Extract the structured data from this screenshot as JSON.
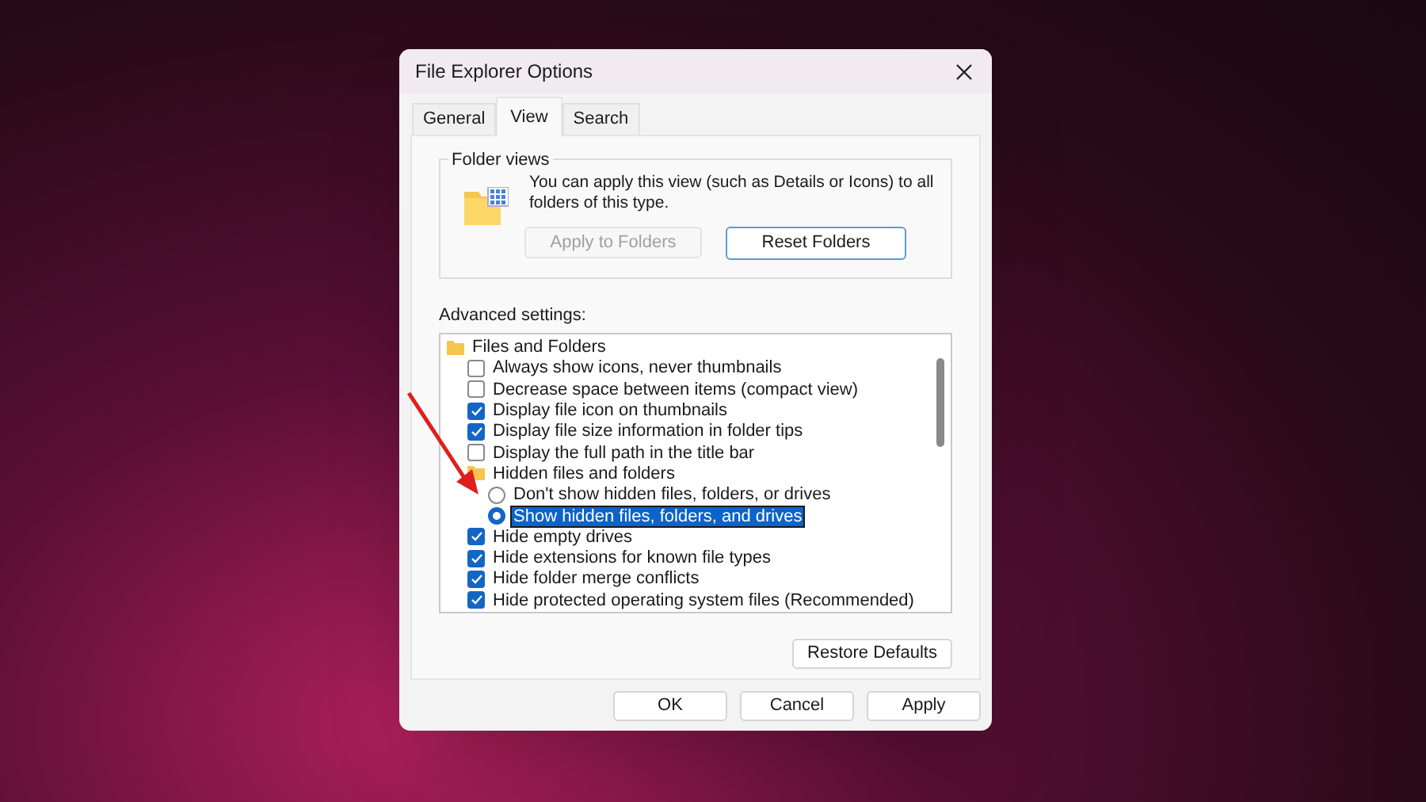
{
  "window": {
    "title": "File Explorer Options"
  },
  "tabs": [
    {
      "label": "General",
      "selected": false
    },
    {
      "label": "View",
      "selected": true
    },
    {
      "label": "Search",
      "selected": false
    }
  ],
  "folder_views": {
    "title": "Folder views",
    "description": "You can apply this view (such as Details or Icons) to all folders of this type.",
    "buttons": [
      {
        "label": "Apply to Folders",
        "disabled": true
      },
      {
        "label": "Reset Folders",
        "disabled": false
      }
    ]
  },
  "advanced_settings": {
    "label": "Advanced settings:",
    "items": [
      {
        "kind": "folder",
        "label": "Files and Folders",
        "children": [
          {
            "kind": "checkbox",
            "label": "Always show icons, never thumbnails",
            "checked": false
          },
          {
            "kind": "checkbox",
            "label": "Decrease space between items (compact view)",
            "checked": false
          },
          {
            "kind": "checkbox",
            "label": "Display file icon on thumbnails",
            "checked": true
          },
          {
            "kind": "checkbox",
            "label": "Display file size information in folder tips",
            "checked": true
          },
          {
            "kind": "checkbox",
            "label": "Display the full path in the title bar",
            "checked": false
          },
          {
            "kind": "folder",
            "label": "Hidden files and folders",
            "children": [
              {
                "kind": "radio",
                "label": "Don't show hidden files, folders, or drives",
                "selected": false
              },
              {
                "kind": "radio",
                "label": "Show hidden files, folders, and drives",
                "selected": true
              }
            ]
          },
          {
            "kind": "checkbox",
            "label": "Hide empty drives",
            "checked": true
          },
          {
            "kind": "checkbox",
            "label": "Hide extensions for known file types",
            "checked": true
          },
          {
            "kind": "checkbox",
            "label": "Hide folder merge conflicts",
            "checked": true
          },
          {
            "kind": "checkbox",
            "label": "Hide protected operating system files (Recommended)",
            "checked": true
          }
        ]
      }
    ]
  },
  "restore_button": "Restore Defaults",
  "dialog_buttons": [
    "OK",
    "Cancel",
    "Apply"
  ]
}
